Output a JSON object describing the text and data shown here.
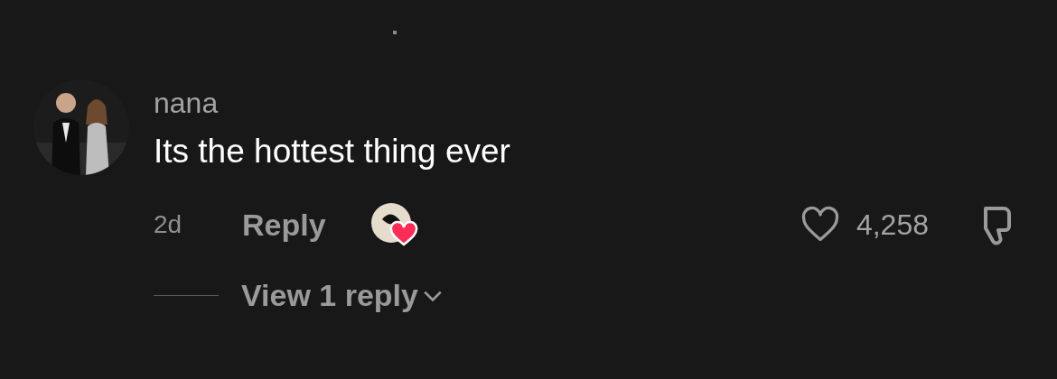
{
  "comment": {
    "username": "nana",
    "text": "Its the hottest thing ever",
    "time": "2d",
    "reply_label": "Reply",
    "creator_liked": true,
    "liked": false,
    "likes": "4,258",
    "disliked": false
  },
  "replies": {
    "label": "View 1 reply"
  }
}
